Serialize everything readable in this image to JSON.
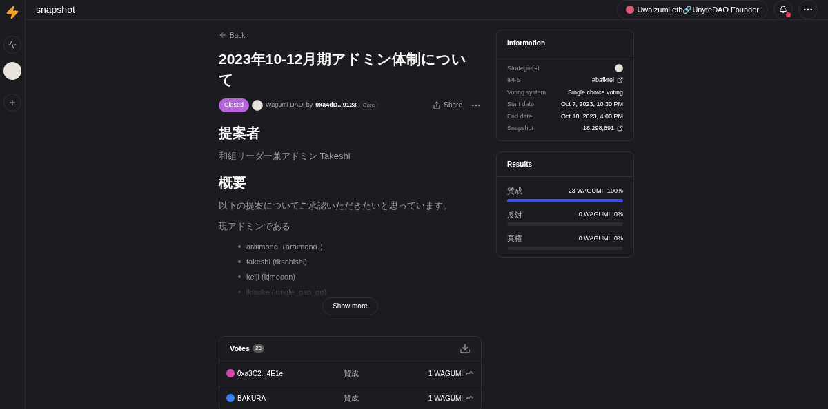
{
  "header": {
    "brand": "snapshot",
    "account": "Uwaizumi.eth🔗UnyteDAO Founder",
    "has_notification": true
  },
  "back": "Back",
  "proposal": {
    "title": "2023年10-12月期アドミン体制について",
    "status": "Closed",
    "space": "Wagumi DAO",
    "by": "by",
    "author": "0xa4dD...9123",
    "author_badge": "Core",
    "share": "Share"
  },
  "body": [
    {
      "kind": "heading",
      "text": "提案者"
    },
    {
      "kind": "paragraph",
      "text": "和組リーダー兼アドミン Takeshi"
    },
    {
      "kind": "heading",
      "text": "概要"
    },
    {
      "kind": "paragraph",
      "text": "以下の提案についてご承認いただきたいと思っています。"
    },
    {
      "kind": "paragraph",
      "text": "現アドミンである"
    },
    {
      "kind": "list",
      "items": [
        "araimono（araimono.）",
        "takeshi (tksohishi)",
        "keiji (kjmooon)",
        "ikisuke (jungle_gap_gg)"
      ]
    }
  ],
  "show_more": "Show more",
  "votes": {
    "title": "Votes",
    "count": "23",
    "rows": [
      {
        "voter": "0xa3C2...4E1e",
        "choice": "賛成",
        "amount": "1 WAGUMI",
        "color": "#d946a8"
      },
      {
        "voter": "BAKURA",
        "choice": "賛成",
        "amount": "1 WAGUMI",
        "color": "#3b82f6"
      }
    ]
  },
  "information": {
    "title": "Information",
    "rows": [
      {
        "label": "Strategie(s)",
        "kind": "avatar"
      },
      {
        "label": "IPFS",
        "value": "#bafkrei",
        "kind": "link"
      },
      {
        "label": "Voting system",
        "value": "Single choice voting",
        "kind": "text"
      },
      {
        "label": "Start date",
        "value": "Oct 7, 2023, 10:30 PM",
        "kind": "text"
      },
      {
        "label": "End date",
        "value": "Oct 10, 2023, 4:00 PM",
        "kind": "text"
      },
      {
        "label": "Snapshot",
        "value": "18,298,891",
        "kind": "link"
      }
    ]
  },
  "results": {
    "title": "Results",
    "choices": [
      {
        "label": "賛成",
        "amount": "23 WAGUMI",
        "percent": "100%",
        "level": 1
      },
      {
        "label": "反対",
        "amount": "0 WAGUMI",
        "percent": "0%",
        "level": 0
      },
      {
        "label": "棄権",
        "amount": "0 WAGUMI",
        "percent": "0%",
        "level": 0
      }
    ]
  }
}
